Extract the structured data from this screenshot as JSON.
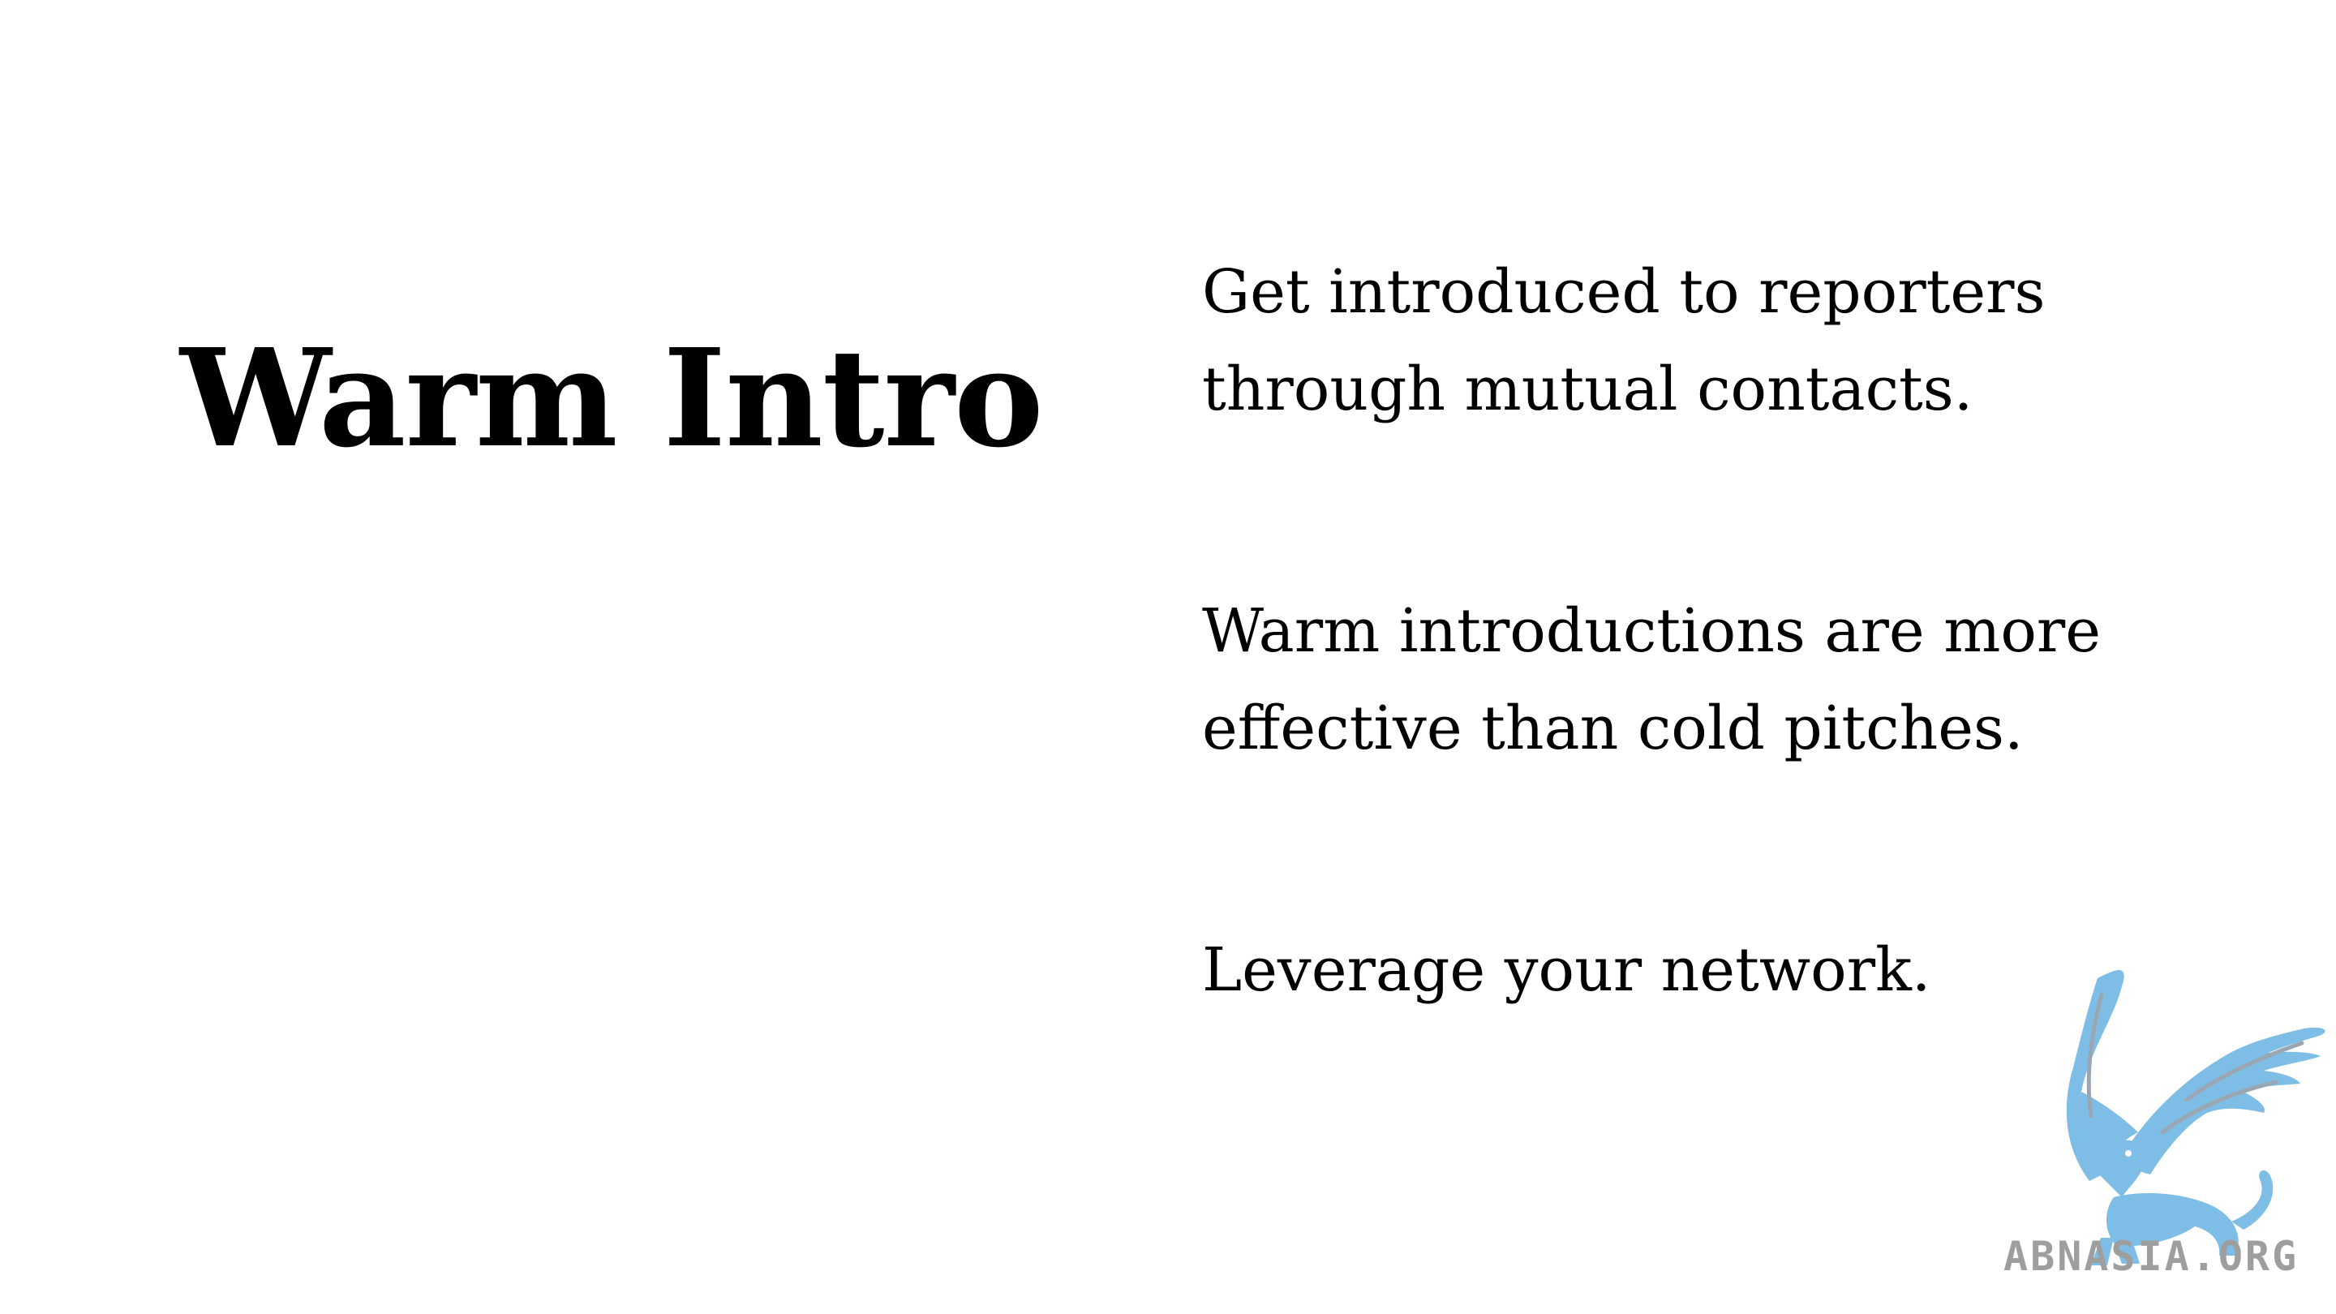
{
  "slide": {
    "title": "Warm Intro",
    "paragraphs": [
      "Get introduced to reporters\nthrough mutual contacts.",
      "Warm introductions are more\neffective than cold pitches.",
      "Leverage your network."
    ],
    "logo": {
      "icon": "griffin-icon",
      "wordmark": "ABNASIA.ORG",
      "colors": {
        "griffin": "#7dbde6",
        "accent": "#9aa7b3",
        "wordmark": "#9e9e9e"
      }
    }
  }
}
